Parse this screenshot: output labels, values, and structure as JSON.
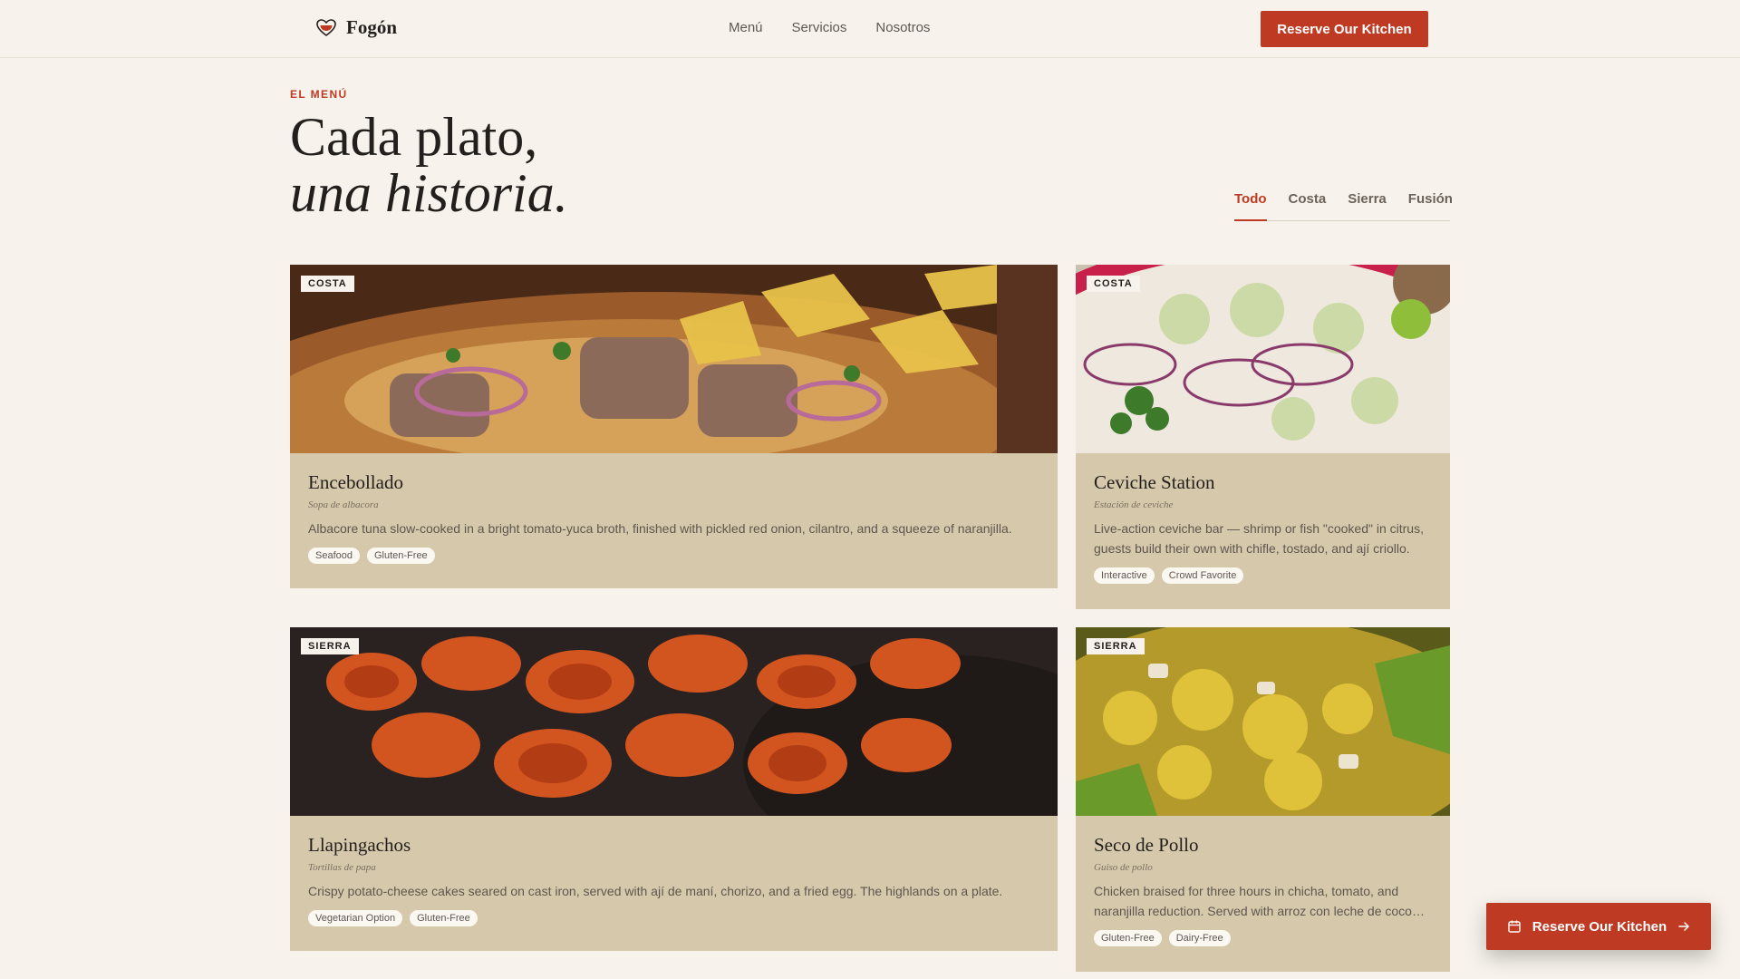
{
  "header": {
    "brand": "Fogón",
    "nav": [
      "Menú",
      "Servicios",
      "Nosotros"
    ],
    "cta_label": "Reserve Our Kitchen"
  },
  "menu_section": {
    "eyebrow": "EL MENÚ",
    "headline_line1": "Cada plato,",
    "headline_line2": "una historia.",
    "filters": [
      "Todo",
      "Costa",
      "Sierra",
      "Fusión"
    ],
    "active_filter": "Todo"
  },
  "dishes": [
    {
      "region": "COSTA",
      "name": "Encebollado",
      "subtitle": "Sopa de albacora",
      "description": "Albacore tuna slow-cooked in a bright tomato-yuca broth, finished with pickled red onion, cilantro, and a squeeze of naranjilla.",
      "tags": [
        "Seafood",
        "Gluten-Free"
      ]
    },
    {
      "region": "COSTA",
      "name": "Ceviche Station",
      "subtitle": "Estación de ceviche",
      "description": "Live-action ceviche bar — shrimp or fish \"cooked\" in citrus, guests build their own with chifle, tostado, and ají criollo.",
      "tags": [
        "Interactive",
        "Crowd Favorite"
      ]
    },
    {
      "region": "SIERRA",
      "name": "Llapingachos",
      "subtitle": "Tortillas de papa",
      "description": "Crispy potato-cheese cakes seared on cast iron, served with ají de maní, chorizo, and a fried egg. The highlands on a plate.",
      "tags": [
        "Vegetarian Option",
        "Gluten-Free"
      ]
    },
    {
      "region": "SIERRA",
      "name": "Seco de Pollo",
      "subtitle": "Guiso de pollo",
      "description": "Chicken braised for three hours in chicha, tomato, and naranjilla reduction. Served with arroz con leche de coco and maduros.",
      "tags": [
        "Gluten-Free",
        "Dairy-Free"
      ]
    }
  ],
  "floating_cta": {
    "label": "Reserve Our Kitchen"
  },
  "colors": {
    "accent": "#bf3a22",
    "background": "#f7f3ec",
    "card": "#d5c8ab"
  }
}
